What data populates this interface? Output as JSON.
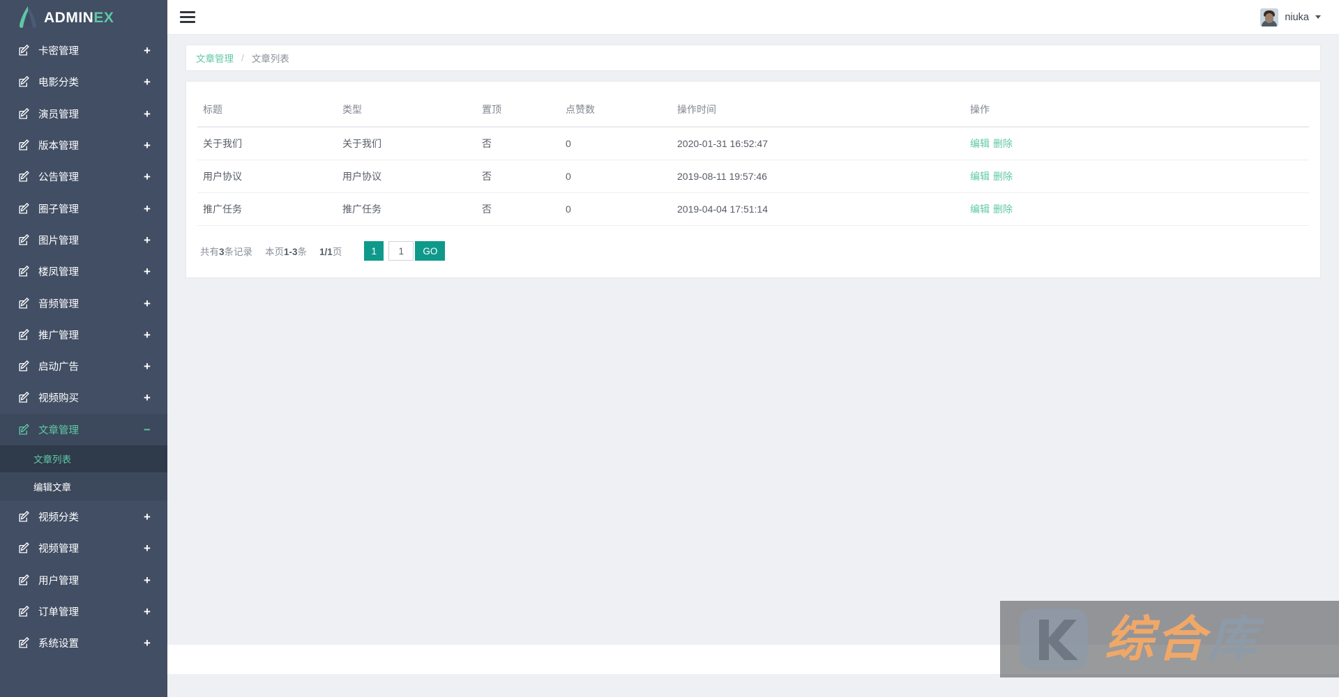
{
  "brand": {
    "name_dark": "ADMIN",
    "name_accent": "EX",
    "logo_icon": "triangle-logo-icon"
  },
  "header": {
    "hamburger_icon": "hamburger-menu-icon",
    "user_name": "niuka",
    "avatar_icon": "user-avatar",
    "caret_icon": "chevron-down-icon"
  },
  "sidebar": {
    "items": [
      {
        "label": "卡密管理",
        "icon": "edit-square-icon",
        "toggle": "+"
      },
      {
        "label": "电影分类",
        "icon": "edit-square-icon",
        "toggle": "+"
      },
      {
        "label": "演员管理",
        "icon": "edit-square-icon",
        "toggle": "+"
      },
      {
        "label": "版本管理",
        "icon": "edit-square-icon",
        "toggle": "+"
      },
      {
        "label": "公告管理",
        "icon": "edit-square-icon",
        "toggle": "+"
      },
      {
        "label": "圈子管理",
        "icon": "edit-square-icon",
        "toggle": "+"
      },
      {
        "label": "图片管理",
        "icon": "edit-square-icon",
        "toggle": "+"
      },
      {
        "label": "楼凤管理",
        "icon": "edit-square-icon",
        "toggle": "+"
      },
      {
        "label": "音频管理",
        "icon": "edit-square-icon",
        "toggle": "+"
      },
      {
        "label": "推广管理",
        "icon": "edit-square-icon",
        "toggle": "+"
      },
      {
        "label": "启动广告",
        "icon": "edit-square-icon",
        "toggle": "+"
      },
      {
        "label": "视频购买",
        "icon": "edit-square-icon",
        "toggle": "+"
      },
      {
        "label": "文章管理",
        "icon": "edit-square-icon",
        "toggle": "−",
        "active": true,
        "submenu": [
          {
            "label": "文章列表",
            "current": true
          },
          {
            "label": "编辑文章",
            "current": false
          }
        ]
      },
      {
        "label": "视频分类",
        "icon": "edit-square-icon",
        "toggle": "+"
      },
      {
        "label": "视频管理",
        "icon": "edit-square-icon",
        "toggle": "+"
      },
      {
        "label": "用户管理",
        "icon": "edit-square-icon",
        "toggle": "+"
      },
      {
        "label": "订单管理",
        "icon": "edit-square-icon",
        "toggle": "+"
      },
      {
        "label": "系统设置",
        "icon": "edit-square-icon",
        "toggle": "+"
      }
    ]
  },
  "breadcrumb": {
    "parent": "文章管理",
    "separator": "/",
    "current": "文章列表"
  },
  "table": {
    "headers": [
      "标题",
      "类型",
      "置顶",
      "点赞数",
      "操作时间",
      "操作"
    ],
    "rows": [
      {
        "title": "关于我们",
        "type": "关于我们",
        "top": "否",
        "likes": "0",
        "time": "2020-01-31 16:52:47",
        "edit": "编辑",
        "delete": "删除"
      },
      {
        "title": "用户协议",
        "type": "用户协议",
        "top": "否",
        "likes": "0",
        "time": "2019-08-11 19:57:46",
        "edit": "编辑",
        "delete": "删除"
      },
      {
        "title": "推广任务",
        "type": "推广任务",
        "top": "否",
        "likes": "0",
        "time": "2019-04-04 17:51:14",
        "edit": "编辑",
        "delete": "删除"
      }
    ]
  },
  "pagination": {
    "total_prefix": "共有",
    "total_count": "3",
    "total_suffix": "条记录",
    "page_prefix": "本页",
    "page_range": "1-3",
    "page_suffix": "条",
    "index_current": "1/1",
    "index_suffix": "页",
    "current_page_button": "1",
    "jump_value": "1",
    "go_label": "GO"
  },
  "watermark": {
    "logo_letter": "K",
    "text_orange": "综合",
    "text_gray": "库"
  },
  "colors": {
    "sidebar_bg": "#414e64",
    "sidebar_active_bg": "#3c485c",
    "submenu_current_bg": "#2f3a4b",
    "accent_green": "#5fc8a4",
    "button_teal": "#0f998a",
    "page_bg": "#eef0f4",
    "watermark_orange": "#f0a868"
  }
}
